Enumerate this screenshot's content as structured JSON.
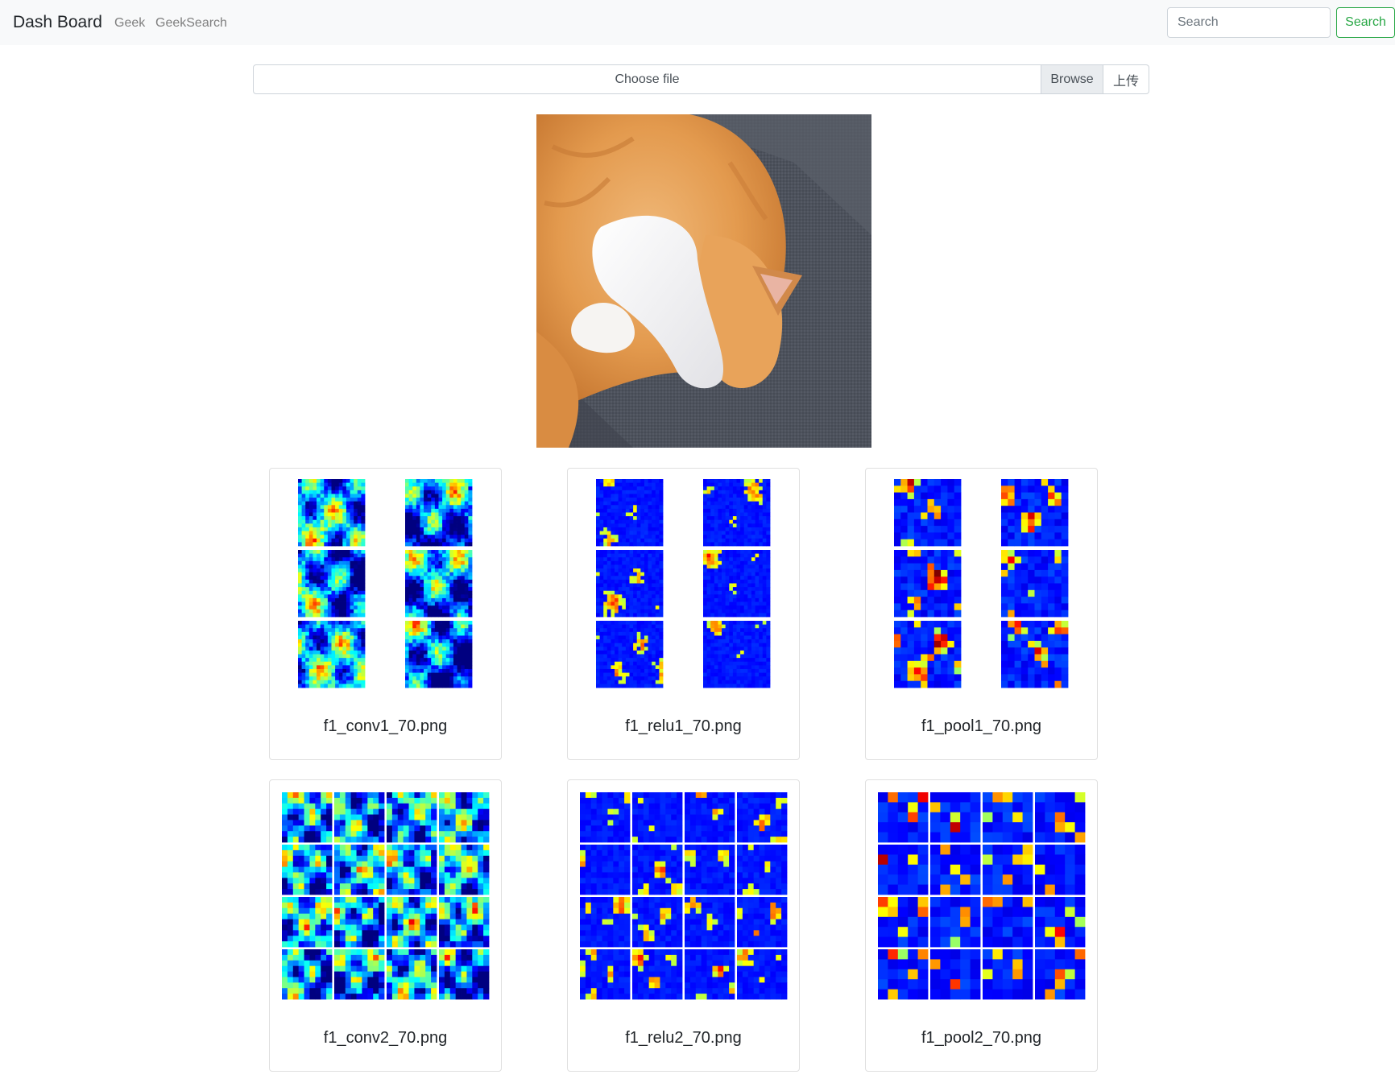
{
  "navbar": {
    "brand": "Dash Board",
    "links": [
      "Geek",
      "GeekSearch"
    ],
    "search_placeholder": "Search",
    "search_button": "Search"
  },
  "upload": {
    "file_label": "Choose file",
    "browse_label": "Browse",
    "submit_label": "上传"
  },
  "colors": {
    "navbar_bg": "#f8f9fa",
    "search_accent": "#28a745",
    "card_border": "#dfdfdf"
  },
  "main_image": {
    "description_icon": "cat-photo"
  },
  "cards": [
    {
      "title": "f1_conv1_70.png",
      "layout": "2x3"
    },
    {
      "title": "f1_relu1_70.png",
      "layout": "2x3"
    },
    {
      "title": "f1_pool1_70.png",
      "layout": "2x3"
    },
    {
      "title": "f1_conv2_70.png",
      "layout": "4x4"
    },
    {
      "title": "f1_relu2_70.png",
      "layout": "4x4"
    },
    {
      "title": "f1_pool2_70.png",
      "layout": "4x4"
    }
  ]
}
